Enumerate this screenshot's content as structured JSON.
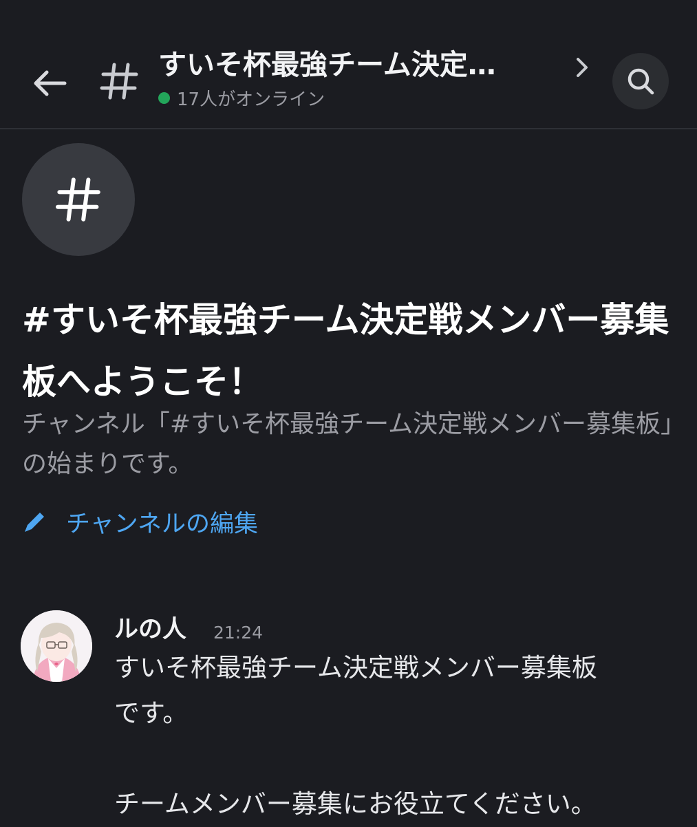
{
  "header": {
    "title": "すいそ杯最強チーム決定…",
    "online_text": "17人がオンライン",
    "online_color": "#23a55a"
  },
  "icons": {
    "back": "arrow-left-icon",
    "channel": "hash-icon",
    "chevron": "chevron-right-icon",
    "search": "search-icon",
    "edit": "pencil-icon"
  },
  "welcome": {
    "title": "#すいそ杯最強チーム決定戦メンバー募集板へようこそ！",
    "description": "チャンネル「#すいそ杯最強チーム決定戦メンバー募集板」の始まりです。",
    "edit_label": "チャンネルの編集",
    "accent_color": "#4ea6f2"
  },
  "message": {
    "author": "ルの人",
    "time": "21:24",
    "lines": [
      "すいそ杯最強チーム決定戦メンバー募集板",
      "です。",
      "",
      "チームメンバー募集にお役立てください。"
    ]
  }
}
